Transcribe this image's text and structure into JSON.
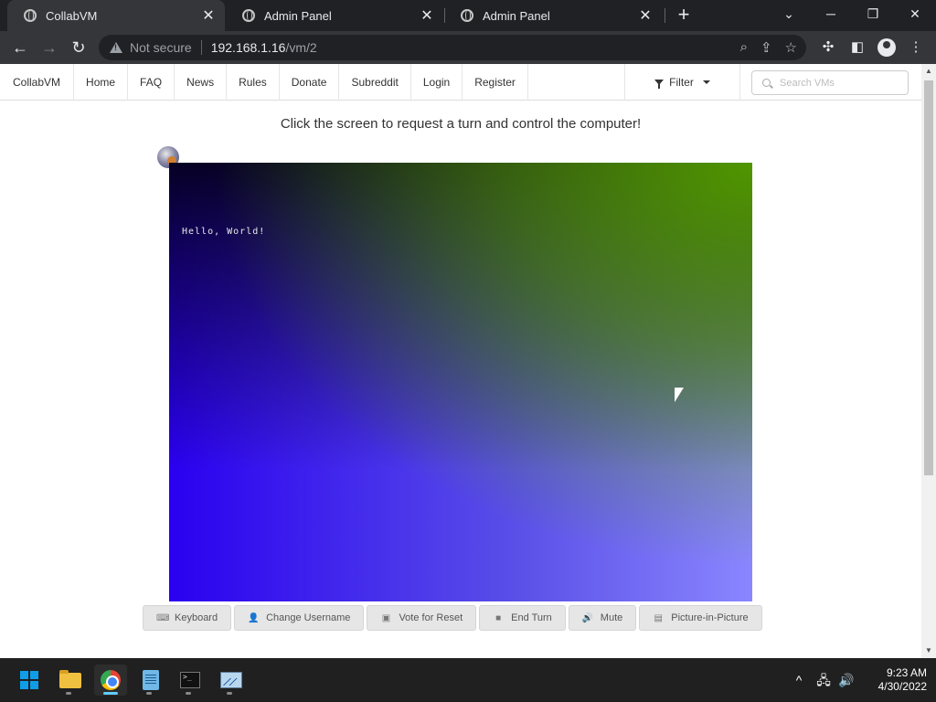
{
  "browser": {
    "tabs": [
      {
        "title": "CollabVM",
        "active": true
      },
      {
        "title": "Admin Panel",
        "active": false
      },
      {
        "title": "Admin Panel",
        "active": false
      }
    ],
    "security_label": "Not secure",
    "url_host": "192.168.1.16",
    "url_path": "/vm/2"
  },
  "site_nav": {
    "brand": "CollabVM",
    "items": [
      "Home",
      "FAQ",
      "News",
      "Rules",
      "Donate",
      "Subreddit",
      "Login",
      "Register"
    ],
    "filter_label": "Filter",
    "search_placeholder": "Search VMs"
  },
  "main": {
    "instruction": "Click the screen to request a turn and control the computer!",
    "vm_text": "Hello, World!"
  },
  "vm_buttons": [
    {
      "label": "Keyboard",
      "icon": "keyboard-icon"
    },
    {
      "label": "Change Username",
      "icon": "user-icon"
    },
    {
      "label": "Vote for Reset",
      "icon": "vote-icon"
    },
    {
      "label": "End Turn",
      "icon": "stop-icon"
    },
    {
      "label": "Mute",
      "icon": "speaker-icon"
    },
    {
      "label": "Picture-in-Picture",
      "icon": "pip-icon"
    }
  ],
  "taskbar": {
    "time": "9:23 AM",
    "date": "4/30/2022",
    "apps": [
      "start",
      "file-explorer",
      "chrome",
      "notepad",
      "terminal",
      "monitor"
    ]
  },
  "colors": {
    "browser_frame": "#202124",
    "toolbar": "#35363a",
    "taskbar": "#202020",
    "vm_blue": "#2a00f0",
    "vm_green": "#509600"
  }
}
